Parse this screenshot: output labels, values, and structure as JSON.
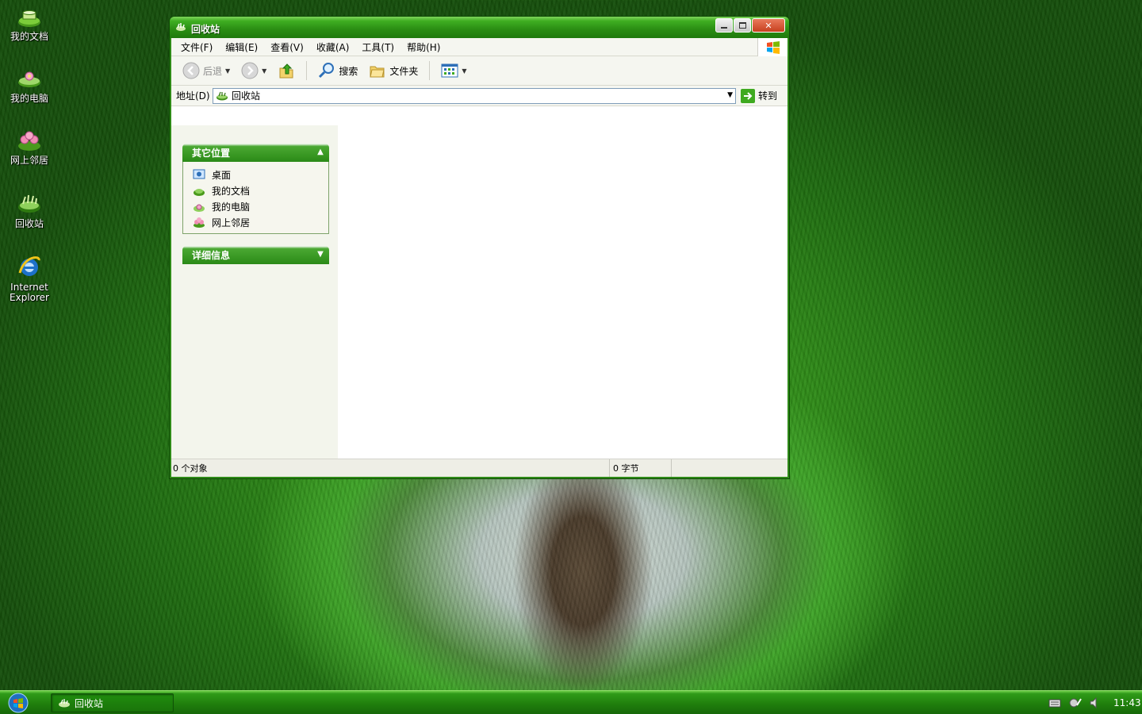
{
  "desktop": {
    "icons": [
      {
        "label": "我的文档",
        "icon": "my-documents-icon"
      },
      {
        "label": "我的电脑",
        "icon": "my-computer-icon"
      },
      {
        "label": "网上邻居",
        "icon": "network-places-icon"
      },
      {
        "label": "回收站",
        "icon": "recycle-bin-icon"
      },
      {
        "label": "Internet\nExplorer",
        "icon": "internet-explorer-icon"
      }
    ]
  },
  "window": {
    "title": "回收站",
    "menu": [
      "文件(F)",
      "编辑(E)",
      "查看(V)",
      "收藏(A)",
      "工具(T)",
      "帮助(H)"
    ],
    "toolbar": {
      "back_label": "后退",
      "search_label": "搜索",
      "folders_label": "文件夹"
    },
    "address": {
      "label": "地址(D)",
      "value": "回收站",
      "go_label": "转到"
    },
    "taskpane": {
      "other_places": {
        "title": "其它位置",
        "items": [
          "桌面",
          "我的文档",
          "我的电脑",
          "网上邻居"
        ]
      },
      "details": {
        "title": "详细信息"
      }
    },
    "status": {
      "objects": "0 个对象",
      "size": "0 字节"
    }
  },
  "taskbar": {
    "task_label": "回收站",
    "clock": "11:43"
  },
  "colors": {
    "titlebar": "#2a8d13",
    "accent": "#3fae22"
  }
}
